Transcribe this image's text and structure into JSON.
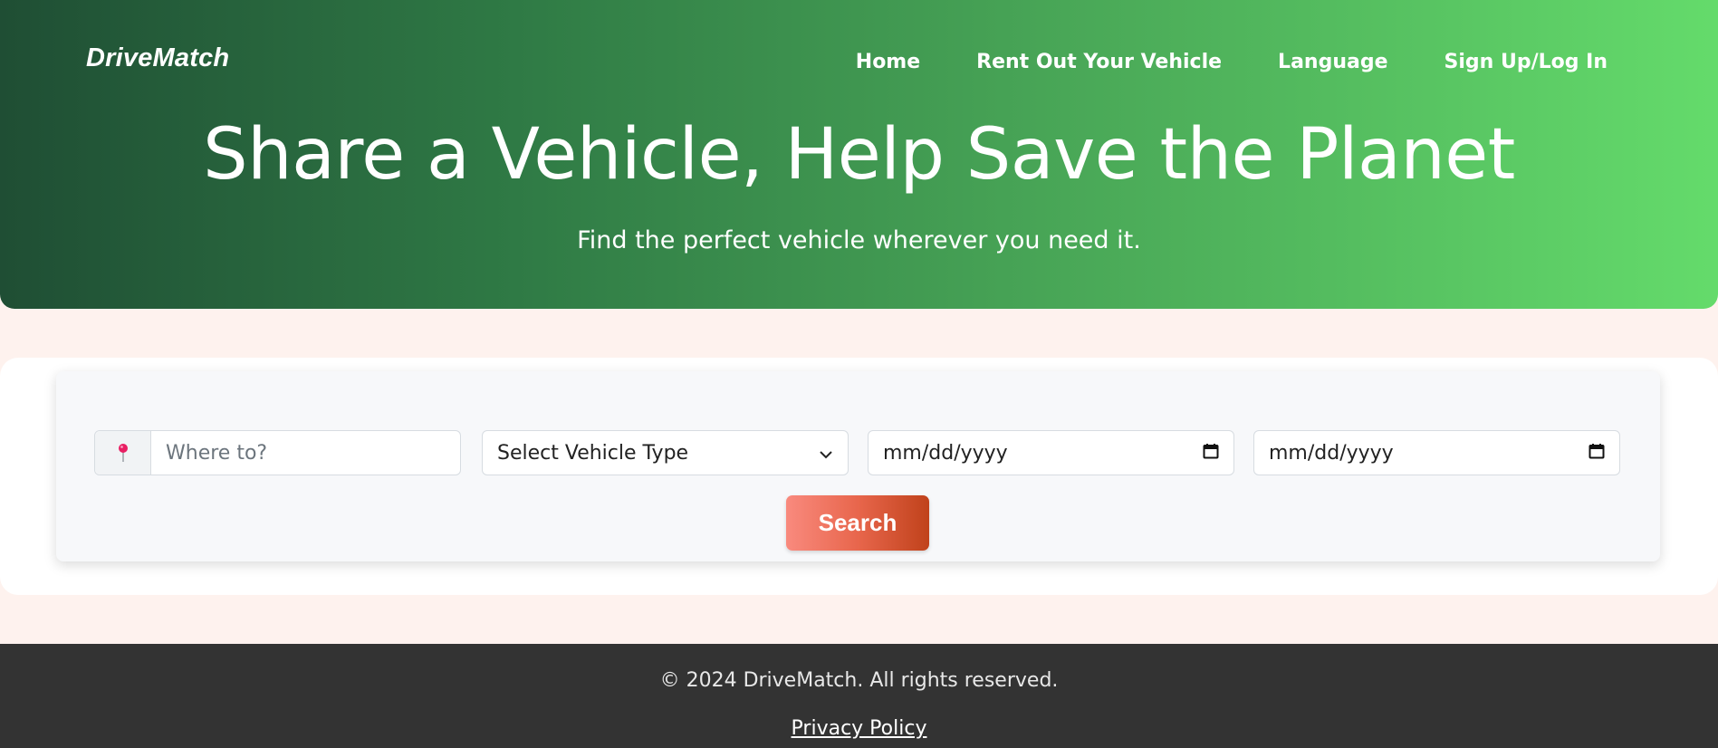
{
  "header": {
    "logo": "DriveMatch",
    "nav": [
      "Home",
      "Rent Out Your Vehicle",
      "Language",
      "Sign Up/Log In"
    ]
  },
  "hero": {
    "title": "Share a Vehicle, Help Save the Planet",
    "subtitle": "Find the perfect vehicle wherever you need it."
  },
  "search": {
    "location_placeholder": "Where to?",
    "vehicle_type_selected": "Select Vehicle Type",
    "start_date_placeholder": "mm/dd/yyyy",
    "end_date_placeholder": "mm/dd/yyyy",
    "button_label": "Search",
    "pin_color": "#e91e63"
  },
  "footer": {
    "copyright": "© 2024 DriveMatch. All rights reserved.",
    "privacy": "Privacy Policy"
  }
}
